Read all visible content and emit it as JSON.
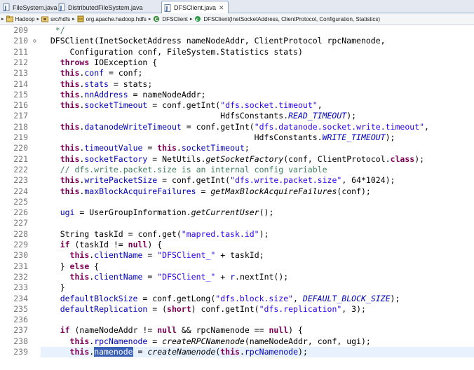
{
  "tabs": [
    {
      "label": "FileSystem.java",
      "active": false
    },
    {
      "label": "DistributedFileSystem.java",
      "active": false
    },
    {
      "label": "DFSClient.java",
      "active": true
    }
  ],
  "tab_close_glyph": "✕",
  "breadcrumb": [
    {
      "label": "Hadoop",
      "icon": "project-icon"
    },
    {
      "label": "src/hdfs",
      "icon": "source-folder-icon"
    },
    {
      "label": "org.apache.hadoop.hdfs",
      "icon": "package-icon"
    },
    {
      "label": "DFSClient",
      "icon": "class-icon"
    },
    {
      "label": "DFSClient(InetSocketAddress, ClientProtocol, Configuration, Statistics)",
      "icon": "constructor-icon"
    }
  ],
  "breadcrumb_sep": "▸",
  "colors": {
    "keyword": "#7f0055",
    "field": "#0000c0",
    "string": "#2a00ff",
    "comment": "#3f7f5f",
    "selection": "#3a61b5",
    "current_line": "#e8f2fe"
  },
  "editor": {
    "current_line": 239,
    "selected_text": "namenode",
    "lines": [
      {
        "n": 209,
        "fold": "",
        "segs": [
          [
            "c",
            "   */"
          ]
        ]
      },
      {
        "n": 210,
        "fold": "⊖",
        "segs": [
          [
            "p",
            "  DFSClient(InetSocketAddress nameNodeAddr, ClientProtocol rpcNamenode,"
          ]
        ]
      },
      {
        "n": 211,
        "fold": "",
        "segs": [
          [
            "p",
            "      Configuration conf, FileSystem.Statistics stats)"
          ]
        ]
      },
      {
        "n": 212,
        "fold": "",
        "segs": [
          [
            "p",
            "    "
          ],
          [
            "k",
            "throws"
          ],
          [
            "p",
            " IOException {"
          ]
        ]
      },
      {
        "n": 213,
        "fold": "",
        "segs": [
          [
            "p",
            "    "
          ],
          [
            "k",
            "this"
          ],
          [
            "p",
            "."
          ],
          [
            "f",
            "conf"
          ],
          [
            "p",
            " = conf;"
          ]
        ]
      },
      {
        "n": 214,
        "fold": "",
        "segs": [
          [
            "p",
            "    "
          ],
          [
            "k",
            "this"
          ],
          [
            "p",
            "."
          ],
          [
            "f",
            "stats"
          ],
          [
            "p",
            " = stats;"
          ]
        ]
      },
      {
        "n": 215,
        "fold": "",
        "segs": [
          [
            "p",
            "    "
          ],
          [
            "k",
            "this"
          ],
          [
            "p",
            "."
          ],
          [
            "f",
            "nnAddress"
          ],
          [
            "p",
            " = nameNodeAddr;"
          ]
        ]
      },
      {
        "n": 216,
        "fold": "",
        "segs": [
          [
            "p",
            "    "
          ],
          [
            "k",
            "this"
          ],
          [
            "p",
            "."
          ],
          [
            "f",
            "socketTimeout"
          ],
          [
            "p",
            " = conf.getInt("
          ],
          [
            "s",
            "\"dfs.socket.timeout\""
          ],
          [
            "p",
            ","
          ]
        ]
      },
      {
        "n": 217,
        "fold": "",
        "segs": [
          [
            "p",
            "                                     HdfsConstants."
          ],
          [
            "ci",
            "READ_TIMEOUT"
          ],
          [
            "p",
            ");"
          ]
        ]
      },
      {
        "n": 218,
        "fold": "",
        "segs": [
          [
            "p",
            "    "
          ],
          [
            "k",
            "this"
          ],
          [
            "p",
            "."
          ],
          [
            "f",
            "datanodeWriteTimeout"
          ],
          [
            "p",
            " = conf.getInt("
          ],
          [
            "s",
            "\"dfs.datanode.socket.write.timeout\""
          ],
          [
            "p",
            ","
          ]
        ]
      },
      {
        "n": 219,
        "fold": "",
        "segs": [
          [
            "p",
            "                                            HdfsConstants."
          ],
          [
            "ci",
            "WRITE_TIMEOUT"
          ],
          [
            "p",
            ");"
          ]
        ]
      },
      {
        "n": 220,
        "fold": "",
        "segs": [
          [
            "p",
            "    "
          ],
          [
            "k",
            "this"
          ],
          [
            "p",
            "."
          ],
          [
            "f",
            "timeoutValue"
          ],
          [
            "p",
            " = "
          ],
          [
            "k",
            "this"
          ],
          [
            "p",
            "."
          ],
          [
            "f",
            "socketTimeout"
          ],
          [
            "p",
            ";"
          ]
        ]
      },
      {
        "n": 221,
        "fold": "",
        "segs": [
          [
            "p",
            "    "
          ],
          [
            "k",
            "this"
          ],
          [
            "p",
            "."
          ],
          [
            "f",
            "socketFactory"
          ],
          [
            "p",
            " = NetUtils."
          ],
          [
            "i",
            "getSocketFactory"
          ],
          [
            "p",
            "(conf, ClientProtocol."
          ],
          [
            "k",
            "class"
          ],
          [
            "p",
            ");"
          ]
        ]
      },
      {
        "n": 222,
        "fold": "",
        "segs": [
          [
            "p",
            "    "
          ],
          [
            "c",
            "// dfs.write.packet.size is an internal config variable"
          ]
        ]
      },
      {
        "n": 223,
        "fold": "",
        "segs": [
          [
            "p",
            "    "
          ],
          [
            "k",
            "this"
          ],
          [
            "p",
            "."
          ],
          [
            "f",
            "writePacketSize"
          ],
          [
            "p",
            " = conf.getInt("
          ],
          [
            "s",
            "\"dfs.write.packet.size\""
          ],
          [
            "p",
            ", 64*1024);"
          ]
        ]
      },
      {
        "n": 224,
        "fold": "",
        "segs": [
          [
            "p",
            "    "
          ],
          [
            "k",
            "this"
          ],
          [
            "p",
            "."
          ],
          [
            "f",
            "maxBlockAcquireFailures"
          ],
          [
            "p",
            " = "
          ],
          [
            "i",
            "getMaxBlockAcquireFailures"
          ],
          [
            "p",
            "(conf);"
          ]
        ]
      },
      {
        "n": 225,
        "fold": "",
        "segs": [
          [
            "p",
            ""
          ]
        ]
      },
      {
        "n": 226,
        "fold": "",
        "segs": [
          [
            "p",
            "    "
          ],
          [
            "f",
            "ugi"
          ],
          [
            "p",
            " = UserGroupInformation."
          ],
          [
            "i",
            "getCurrentUser"
          ],
          [
            "p",
            "();"
          ]
        ]
      },
      {
        "n": 227,
        "fold": "",
        "segs": [
          [
            "p",
            ""
          ]
        ]
      },
      {
        "n": 228,
        "fold": "",
        "segs": [
          [
            "p",
            "    String taskId = conf.get("
          ],
          [
            "s",
            "\"mapred.task.id\""
          ],
          [
            "p",
            ");"
          ]
        ]
      },
      {
        "n": 229,
        "fold": "",
        "segs": [
          [
            "p",
            "    "
          ],
          [
            "k",
            "if"
          ],
          [
            "p",
            " (taskId != "
          ],
          [
            "k",
            "null"
          ],
          [
            "p",
            ") {"
          ]
        ]
      },
      {
        "n": 230,
        "fold": "",
        "segs": [
          [
            "p",
            "      "
          ],
          [
            "k",
            "this"
          ],
          [
            "p",
            "."
          ],
          [
            "f",
            "clientName"
          ],
          [
            "p",
            " = "
          ],
          [
            "s",
            "\"DFSClient_\""
          ],
          [
            "p",
            " + taskId;"
          ]
        ]
      },
      {
        "n": 231,
        "fold": "",
        "segs": [
          [
            "p",
            "    } "
          ],
          [
            "k",
            "else"
          ],
          [
            "p",
            " {"
          ]
        ]
      },
      {
        "n": 232,
        "fold": "",
        "segs": [
          [
            "p",
            "      "
          ],
          [
            "k",
            "this"
          ],
          [
            "p",
            "."
          ],
          [
            "f",
            "clientName"
          ],
          [
            "p",
            " = "
          ],
          [
            "s",
            "\"DFSClient_\""
          ],
          [
            "p",
            " + "
          ],
          [
            "f",
            "r"
          ],
          [
            "p",
            ".nextInt();"
          ]
        ]
      },
      {
        "n": 233,
        "fold": "",
        "segs": [
          [
            "p",
            "    }"
          ]
        ]
      },
      {
        "n": 234,
        "fold": "",
        "segs": [
          [
            "p",
            "    "
          ],
          [
            "f",
            "defaultBlockSize"
          ],
          [
            "p",
            " = conf.getLong("
          ],
          [
            "s",
            "\"dfs.block.size\""
          ],
          [
            "p",
            ", "
          ],
          [
            "ci",
            "DEFAULT_BLOCK_SIZE"
          ],
          [
            "p",
            ");"
          ]
        ]
      },
      {
        "n": 235,
        "fold": "",
        "segs": [
          [
            "p",
            "    "
          ],
          [
            "f",
            "defaultReplication"
          ],
          [
            "p",
            " = ("
          ],
          [
            "k",
            "short"
          ],
          [
            "p",
            ") conf.getInt("
          ],
          [
            "s",
            "\"dfs.replication\""
          ],
          [
            "p",
            ", 3);"
          ]
        ]
      },
      {
        "n": 236,
        "fold": "",
        "segs": [
          [
            "p",
            ""
          ]
        ]
      },
      {
        "n": 237,
        "fold": "",
        "segs": [
          [
            "p",
            "    "
          ],
          [
            "k",
            "if"
          ],
          [
            "p",
            " (nameNodeAddr != "
          ],
          [
            "k",
            "null"
          ],
          [
            "p",
            " && rpcNamenode == "
          ],
          [
            "k",
            "null"
          ],
          [
            "p",
            ") {"
          ]
        ]
      },
      {
        "n": 238,
        "fold": "",
        "segs": [
          [
            "p",
            "      "
          ],
          [
            "k",
            "this"
          ],
          [
            "p",
            "."
          ],
          [
            "f",
            "rpcNamenode"
          ],
          [
            "p",
            " = "
          ],
          [
            "i",
            "createRPCNamenode"
          ],
          [
            "p",
            "(nameNodeAddr, conf, ugi);"
          ]
        ]
      },
      {
        "n": 239,
        "fold": "",
        "segs": [
          [
            "p",
            "      "
          ],
          [
            "k",
            "this"
          ],
          [
            "p",
            "."
          ],
          [
            "sel",
            "namenode"
          ],
          [
            "p",
            " = "
          ],
          [
            "i",
            "createNamenode"
          ],
          [
            "p",
            "("
          ],
          [
            "k",
            "this"
          ],
          [
            "p",
            "."
          ],
          [
            "f",
            "rpcNamenode"
          ],
          [
            "p",
            ");"
          ]
        ]
      }
    ]
  }
}
